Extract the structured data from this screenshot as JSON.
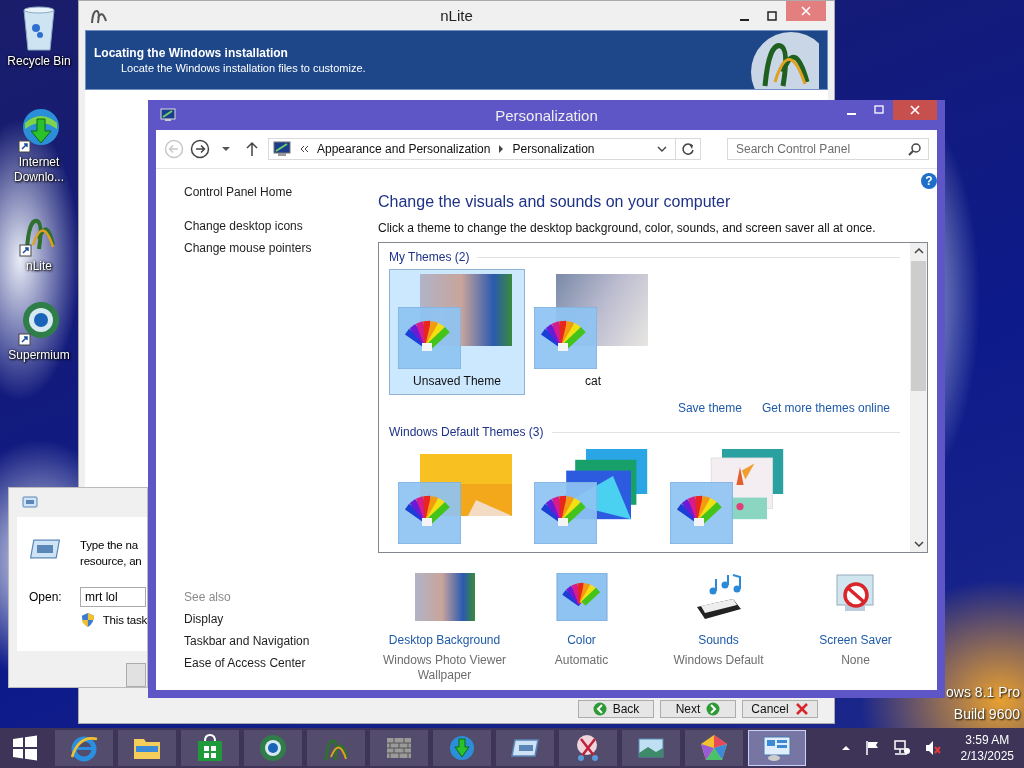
{
  "desktop": {
    "icons": [
      {
        "kind": "recycle",
        "label": "Recycle Bin"
      },
      {
        "kind": "download",
        "label": "Internet Downlo..."
      },
      {
        "kind": "nlite",
        "label": "nLite"
      },
      {
        "kind": "browser",
        "label": "Supermium"
      }
    ],
    "watermark": [
      "ows 8.1 Pro",
      "Build 9600"
    ]
  },
  "nlite": {
    "title": "nLite",
    "header_title": "Locating the Windows installation",
    "header_subtitle": "Locate the Windows installation files to customize.",
    "buttons": [
      {
        "kind": "back",
        "label": "Back"
      },
      {
        "kind": "next",
        "label": "Next"
      },
      {
        "kind": "cancel",
        "label": "Cancel"
      }
    ]
  },
  "run_dialog": {
    "text_lines": [
      "Type the na",
      "resource, an"
    ],
    "open_label": "Open:",
    "value": "mrt lol",
    "admin_note": "This task"
  },
  "personalization": {
    "title": "Personalization",
    "address": [
      "Appearance and Personalization",
      "Personalization"
    ],
    "search_placeholder": "Search Control Panel",
    "help_label": "?",
    "nav": [
      "Control Panel Home",
      "Change desktop icons",
      "Change mouse pointers"
    ],
    "see_also_title": "See also",
    "see_also": [
      "Display",
      "Taskbar and Navigation",
      "Ease of Access Center"
    ],
    "heading": "Change the visuals and sounds on your computer",
    "description": "Click a theme to change the desktop background, color, sounds, and screen saver all at once.",
    "theme_groups": [
      {
        "title": "My Themes (2)",
        "themes": [
          {
            "kind": "portrait",
            "name": "Unsaved Theme",
            "selected": true
          },
          {
            "kind": "cat",
            "name": "cat",
            "selected": false
          }
        ]
      },
      {
        "title": "Windows Default Themes (3)",
        "themes": [
          {
            "kind": "flat",
            "selected": false
          },
          {
            "kind": "layers",
            "selected": false
          },
          {
            "kind": "flowers",
            "selected": false
          }
        ]
      }
    ],
    "links": [
      "Save theme",
      "Get more themes online"
    ],
    "settings": [
      {
        "kind": "background",
        "label": "Desktop Background",
        "value": "Windows Photo Viewer Wallpaper"
      },
      {
        "kind": "color",
        "label": "Color",
        "value": "Automatic"
      },
      {
        "kind": "sounds",
        "label": "Sounds",
        "value": "Windows Default"
      },
      {
        "kind": "screensaver",
        "label": "Screen Saver",
        "value": "None"
      }
    ]
  },
  "taskbar": {
    "apps": [
      {
        "kind": "ie",
        "active": false
      },
      {
        "kind": "explorer",
        "active": false
      },
      {
        "kind": "store",
        "active": false
      },
      {
        "kind": "globe",
        "active": false
      },
      {
        "kind": "nlite",
        "active": false
      },
      {
        "kind": "firewall",
        "active": false
      },
      {
        "kind": "download",
        "active": false
      },
      {
        "kind": "run",
        "active": false
      },
      {
        "kind": "snip",
        "active": false
      },
      {
        "kind": "photos",
        "active": false
      },
      {
        "kind": "pentagon",
        "active": false
      },
      {
        "kind": "control",
        "active": true
      }
    ],
    "time": "3:59 AM",
    "date": "2/13/2025"
  }
}
